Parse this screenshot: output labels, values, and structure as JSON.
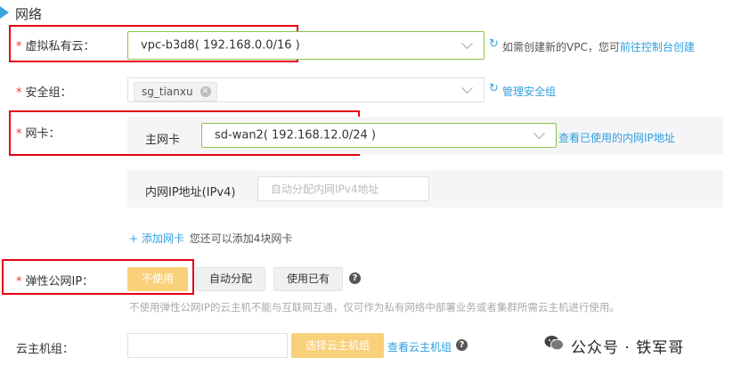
{
  "section": {
    "title": "网络"
  },
  "vpc": {
    "required": "*",
    "label": "虚拟私有云：",
    "value": "vpc-b3d8( 192.168.0.0/16 )",
    "hint": "如需创建新的VPC，您可",
    "link": "前往控制台创建"
  },
  "security_group": {
    "required": "*",
    "label": "安全组：",
    "tag": "sg_tianxu",
    "manage_link": "管理安全组"
  },
  "nic": {
    "required": "*",
    "label": "网卡：",
    "primary_label": "主网卡",
    "primary_value": "sd-wan2( 192.168.12.0/24 )",
    "view_ip_link": "查看已使用的内网IP地址",
    "ip_label": "内网IP地址(IPv4)",
    "ip_placeholder": "自动分配内网IPv4地址",
    "add_link": "添加网卡",
    "add_hint": "您还可以添加4块网卡"
  },
  "eip": {
    "required": "*",
    "label": "弹性公网IP：",
    "options": [
      "不使用",
      "自动分配",
      "使用已有"
    ],
    "selected": "不使用",
    "description": "不使用弹性公网IP的云主机不能与互联网互通，仅可作为私有网络中部署业务或者集群所需云主机进行使用。"
  },
  "host_group": {
    "label": "云主机组：",
    "select_button": "选择云主机组",
    "view_link": "查看云主机组"
  },
  "watermark": {
    "text": "公众号 · 铁军哥"
  },
  "colors": {
    "accent": "#2f9fe0",
    "selected_button": "#fbd07a",
    "required": "#e33",
    "highlight_border": "#e60012"
  }
}
